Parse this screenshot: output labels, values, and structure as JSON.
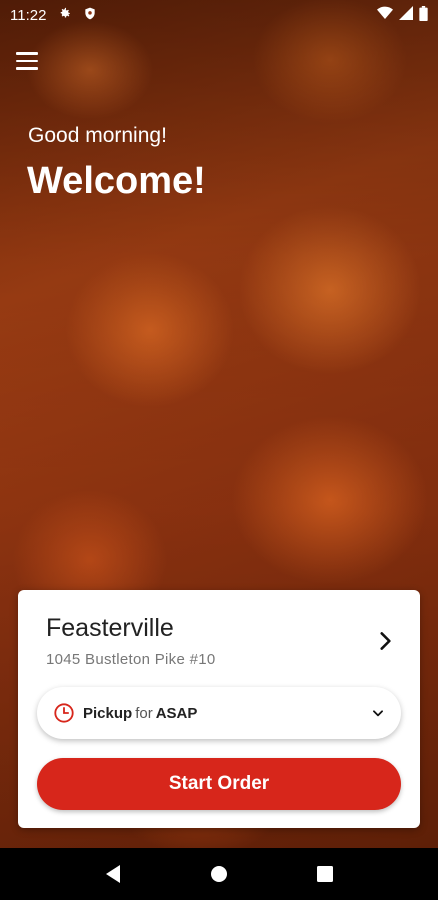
{
  "status_bar": {
    "time": "11:22"
  },
  "hero": {
    "greeting": "Good morning!",
    "title": "Welcome!"
  },
  "store": {
    "name": "Feasterville",
    "address": "1045 Bustleton Pike #10"
  },
  "pickup": {
    "mode": "Pickup",
    "connector": "for",
    "time": "ASAP"
  },
  "actions": {
    "start_order": "Start Order"
  },
  "colors": {
    "accent": "#d7261b",
    "card": "#ffffff"
  }
}
